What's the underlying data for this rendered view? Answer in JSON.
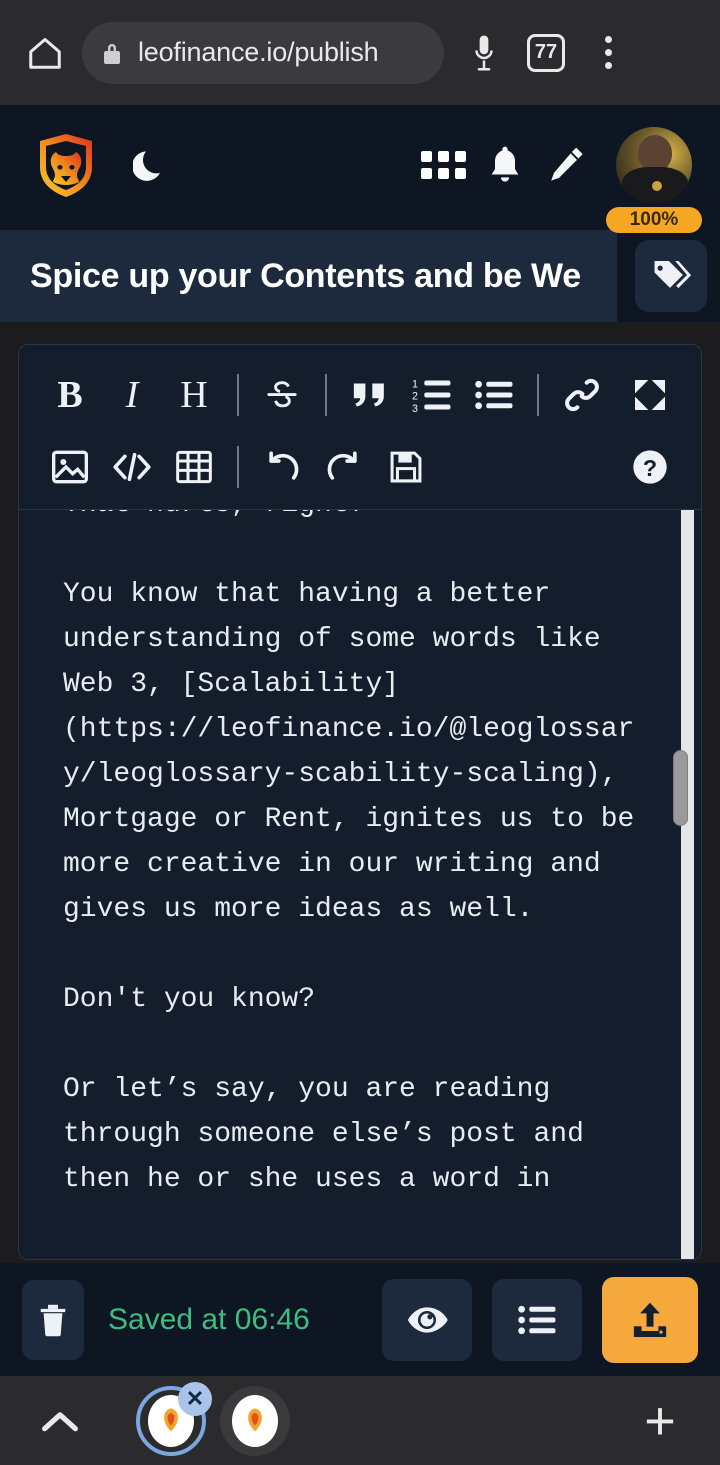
{
  "browser": {
    "home_icon": "home-icon",
    "lock_icon": "lock-icon",
    "url": "leofinance.io/publish",
    "mic_icon": "microphone-icon",
    "tab_count": "77",
    "menu_icon": "kebab-menu-icon"
  },
  "app_header": {
    "logo_icon": "leofinance-lion-logo",
    "theme_toggle_icon": "moon-icon",
    "apps_icon": "grid-apps-icon",
    "notifications_icon": "bell-icon",
    "compose_icon": "pencil-icon",
    "avatar_icon": "user-avatar",
    "voting_power": "100%"
  },
  "post": {
    "title": "Spice up your Contents and be We",
    "tags_button_icon": "tags-icon"
  },
  "toolbar": {
    "row1": [
      {
        "name": "bold-button",
        "label": "B"
      },
      {
        "name": "italic-button",
        "label": "I"
      },
      {
        "name": "heading-button",
        "label": "H"
      },
      {
        "name": "strikethrough-button",
        "label": "S"
      },
      {
        "name": "blockquote-button",
        "label": "“"
      },
      {
        "name": "ordered-list-button",
        "label": "1 2 3"
      },
      {
        "name": "unordered-list-button",
        "label": "bullets"
      },
      {
        "name": "link-button",
        "label": "link"
      },
      {
        "name": "fullscreen-button",
        "label": "expand"
      }
    ],
    "row2": [
      {
        "name": "image-button",
        "label": "image"
      },
      {
        "name": "code-button",
        "label": "</>"
      },
      {
        "name": "table-button",
        "label": "table"
      },
      {
        "name": "undo-button",
        "label": "undo"
      },
      {
        "name": "redo-button",
        "label": "redo"
      },
      {
        "name": "save-button",
        "label": "save"
      },
      {
        "name": "help-button",
        "label": "?"
      }
    ]
  },
  "editor": {
    "content": "That hurts, right?\n\nYou know that having a better understanding of some words like Web 3, [Scalability](https://leofinance.io/@leoglossary/leoglossary-scability-scaling), Mortgage or Rent, ignites us to be more creative in our writing and gives us more ideas as well.\n\nDon't you know?\n\nOr let’s say, you are reading through someone else’s post and then he or she uses a word in"
  },
  "action_bar": {
    "delete_icon": "trash-icon",
    "saved_status": "Saved at 06:46",
    "preview_icon": "eye-icon",
    "options_icon": "list-icon",
    "publish_icon": "upload-icon"
  },
  "tab_strip": {
    "expand_icon": "chevron-up-icon",
    "tabs": [
      {
        "name": "tab-active",
        "favicon": "lion-favicon",
        "active": true,
        "close_label": "✕"
      },
      {
        "name": "tab-second",
        "favicon": "lion-favicon",
        "active": false
      }
    ],
    "new_tab_label": "+"
  },
  "colors": {
    "brand_orange": "#f5a93c",
    "saved_green": "#3fbd7e",
    "app_bg": "#0e1624",
    "panel_bg": "#1d2a3d",
    "editor_bg": "#141d2b",
    "tab_ring": "#7aa7e0"
  }
}
